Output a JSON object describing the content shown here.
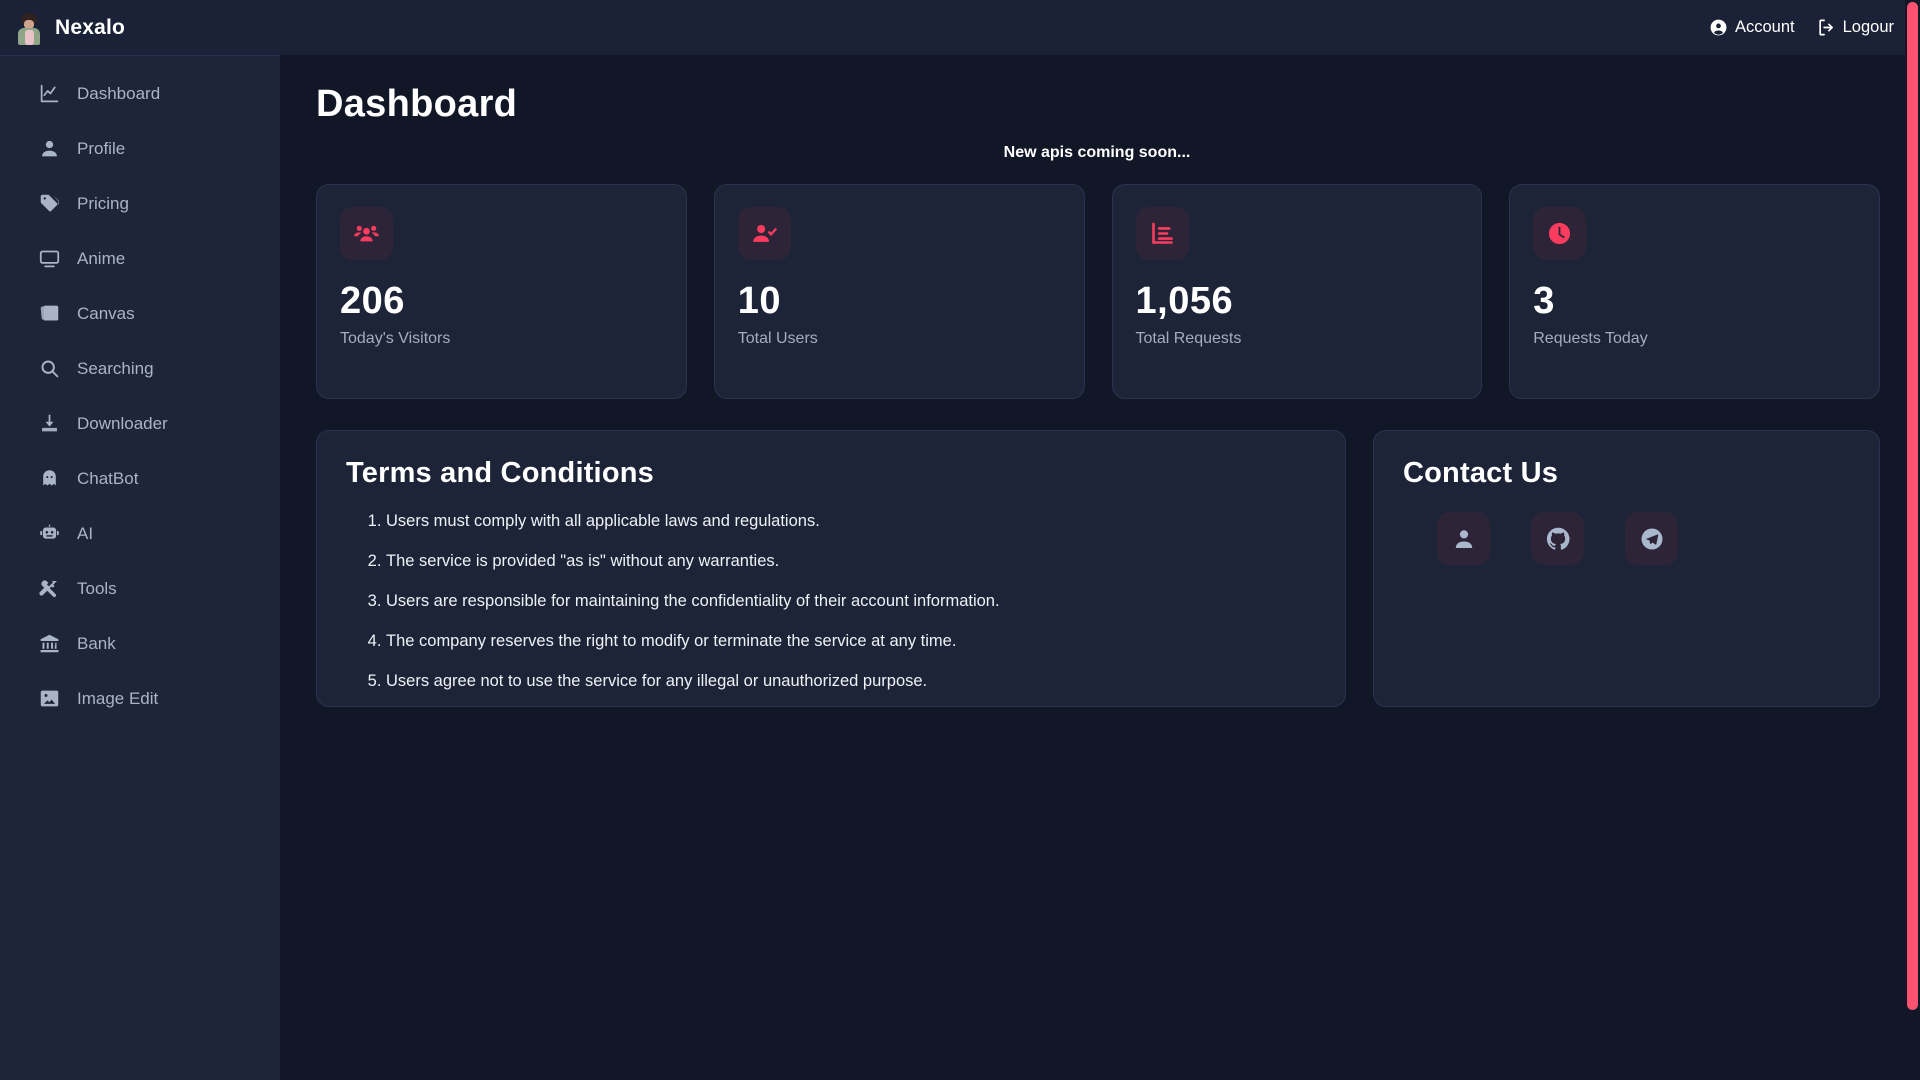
{
  "brand": {
    "name": "Nexalo",
    "avatar_icon": "person-avatar-icon"
  },
  "topbar": {
    "account_label": "Account",
    "account_icon": "user-circle-icon",
    "logout_label": "Logour",
    "logout_icon": "logout-arrow-icon"
  },
  "sidebar": {
    "items": [
      {
        "label": "Dashboard",
        "icon": "chart-line-icon"
      },
      {
        "label": "Profile",
        "icon": "person-icon"
      },
      {
        "label": "Pricing",
        "icon": "tags-icon"
      },
      {
        "label": "Anime",
        "icon": "monitor-icon"
      },
      {
        "label": "Canvas",
        "icon": "images-icon"
      },
      {
        "label": "Searching",
        "icon": "search-icon"
      },
      {
        "label": "Downloader",
        "icon": "download-icon"
      },
      {
        "label": "ChatBot",
        "icon": "ghost-icon"
      },
      {
        "label": "AI",
        "icon": "robot-icon"
      },
      {
        "label": "Tools",
        "icon": "tools-icon"
      },
      {
        "label": "Bank",
        "icon": "bank-icon"
      },
      {
        "label": "Image Edit",
        "icon": "image-icon"
      }
    ]
  },
  "main": {
    "title": "Dashboard",
    "notice": "New apis coming soon...",
    "stats": [
      {
        "value": "206",
        "label": "Today's Visitors",
        "icon": "users-group-icon"
      },
      {
        "value": "10",
        "label": "Total Users",
        "icon": "user-check-icon"
      },
      {
        "value": "1,056",
        "label": "Total Requests",
        "icon": "bar-chart-icon"
      },
      {
        "value": "3",
        "label": "Requests Today",
        "icon": "clock-icon"
      }
    ],
    "terms": {
      "title": "Terms and Conditions",
      "items": [
        "Users must comply with all applicable laws and regulations.",
        "The service is provided \"as is\" without any warranties.",
        "Users are responsible for maintaining the confidentiality of their account information.",
        "The company reserves the right to modify or terminate the service at any time.",
        "Users agree not to use the service for any illegal or unauthorized purpose."
      ]
    },
    "contact": {
      "title": "Contact Us",
      "icons": [
        {
          "icon": "person-icon"
        },
        {
          "icon": "github-icon"
        },
        {
          "icon": "telegram-icon"
        }
      ]
    }
  },
  "colors": {
    "accent": "#fb5271",
    "sidebar_bg": "#1e2439",
    "main_bg": "#121728",
    "card_bg": "#1d2438",
    "card_border": "#2a3250",
    "icon_tile_bg": "#2d2438",
    "muted_text": "#a3acc0"
  },
  "scrollbar": {
    "thumb_color": "#fb5271"
  }
}
